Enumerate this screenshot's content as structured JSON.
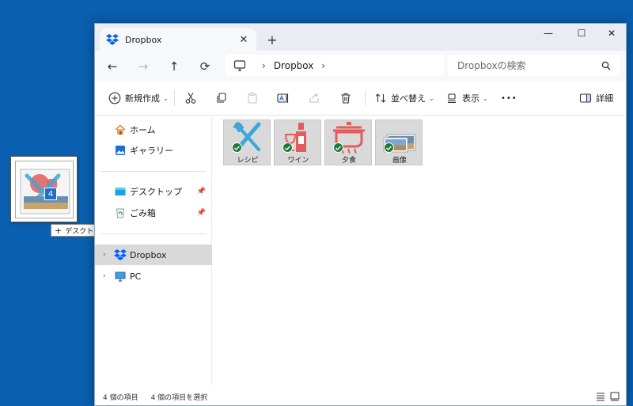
{
  "window": {
    "tab_title": "Dropbox",
    "tab_close": "✕",
    "new_tab": "+",
    "minimize": "—",
    "maximize": "☐",
    "close": "✕"
  },
  "address": {
    "path_item": "Dropbox",
    "search_placeholder": "Dropboxの検索"
  },
  "toolbar": {
    "new_label": "新規作成",
    "sort_label": "並べ替え",
    "view_label": "表示",
    "more_label": "•••",
    "details_label": "詳細"
  },
  "sidebar": {
    "home": "ホーム",
    "gallery": "ギャラリー",
    "desktop": "デスクトップ",
    "recycle_bin": "ごみ箱",
    "dropbox": "Dropbox",
    "pc": "PC"
  },
  "files": [
    {
      "name": "レシピ"
    },
    {
      "name": "ワイン"
    },
    {
      "name": "夕食"
    },
    {
      "name": "画像"
    }
  ],
  "status": {
    "item_count": "4 個の項目",
    "selected_count": "4 個の項目を選択"
  },
  "drag": {
    "count": "4",
    "tooltip": "デスクトップ へコピー"
  },
  "colors": {
    "desktop_bg": "#0a5fb0",
    "sync_check": "#1f7a3c",
    "icon_red": "#e25c5c",
    "icon_blue": "#3aa8d8"
  }
}
